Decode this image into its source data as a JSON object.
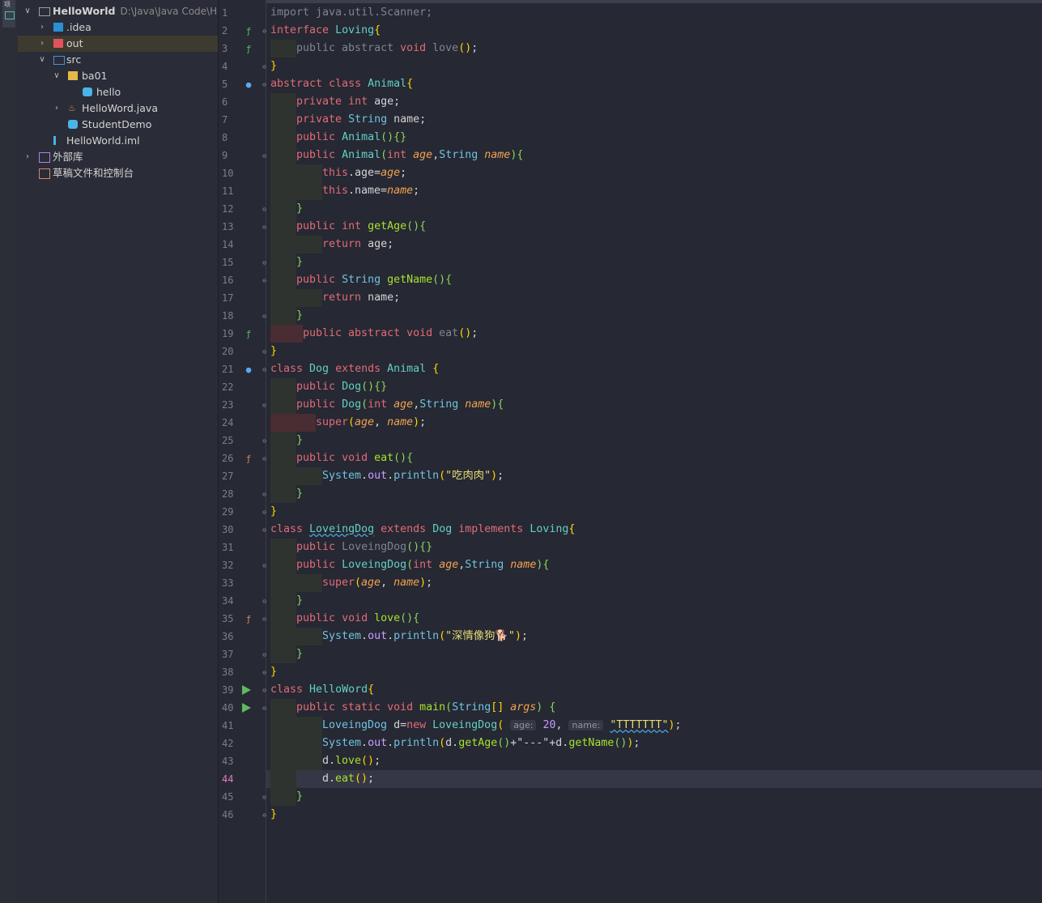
{
  "tool_strip": {
    "label": "项"
  },
  "project_tree": [
    {
      "label": "HelloWorld",
      "path": "D:\\Java\\Java Code\\He",
      "icon": "folder-icon",
      "arrow": "expanded"
    },
    {
      "label": ".idea",
      "icon": "idea-folder-icon",
      "arrow": "collapsed"
    },
    {
      "label": "out",
      "icon": "out-folder-icon",
      "arrow": "collapsed"
    },
    {
      "label": "src",
      "icon": "src-folder-icon",
      "arrow": "expanded"
    },
    {
      "label": "ba01",
      "icon": "package-icon",
      "arrow": "expanded"
    },
    {
      "label": "hello",
      "icon": "class-icon",
      "arrow": ""
    },
    {
      "label": "HelloWord.java",
      "icon": "java-file-icon",
      "arrow": "collapsed"
    },
    {
      "label": "StudentDemo",
      "icon": "class-icon",
      "arrow": ""
    },
    {
      "label": "HelloWorld.iml",
      "icon": "iml-file-icon",
      "arrow": ""
    },
    {
      "label": "外部库",
      "icon": "library-icon",
      "arrow": "collapsed"
    },
    {
      "label": "草稿文件和控制台",
      "icon": "scratch-icon",
      "arrow": ""
    }
  ],
  "editor": {
    "current_line": 44,
    "line_numbers": [
      "1",
      "2",
      "3",
      "4",
      "5",
      "6",
      "7",
      "8",
      "9",
      "10",
      "11",
      "12",
      "13",
      "14",
      "15",
      "16",
      "17",
      "18",
      "19",
      "20",
      "21",
      "22",
      "23",
      "24",
      "25",
      "26",
      "27",
      "28",
      "29",
      "30",
      "31",
      "32",
      "33",
      "34",
      "35",
      "36",
      "37",
      "38",
      "39",
      "40",
      "41",
      "42",
      "43",
      "44",
      "45",
      "46"
    ],
    "code": {
      "l1": "import java.util.Scanner;",
      "l2a": "interface",
      "l2b": "Loving",
      "l3a": "public abstract",
      "l3b": "void",
      "l3c": "love",
      "l5a": "abstract class",
      "l5b": "Animal",
      "l6a": "private",
      "l6b": "int",
      "l6c": "age;",
      "l7a": "private",
      "l7b": "String",
      "l7c": "name;",
      "l8a": "public",
      "l8b": "Animal",
      "l9a": "public",
      "l9b": "Animal",
      "l9c": "int",
      "l9d": "age",
      "l9e": "String",
      "l9f": "name",
      "l10a": "this",
      "l10b": ".age=",
      "l10c": "age",
      "l11a": "this",
      "l11b": ".name=",
      "l11c": "name",
      "l13a": "public",
      "l13b": "int",
      "l13c": "getAge",
      "l14a": "return",
      "l14b": "age;",
      "l16a": "public",
      "l16b": "String",
      "l16c": "getName",
      "l17a": "return",
      "l17b": "name;",
      "l19a": "public abstract",
      "l19b": "void",
      "l19c": "eat",
      "l21a": "class",
      "l21b": "Dog",
      "l21c": "extends",
      "l21d": "Animal",
      "l22a": "public",
      "l22b": "Dog",
      "l23a": "public",
      "l23b": "Dog",
      "l23c": "int",
      "l23d": "age",
      "l23e": "String",
      "l23f": "name",
      "l24a": "super",
      "l24b": "age",
      "l24c": "name",
      "l26a": "public",
      "l26b": "void",
      "l26c": "eat",
      "l27a": "System",
      "l27b": "out",
      "l27c": "println",
      "l27d": "\"吃肉肉\"",
      "l30a": "class",
      "l30b": "LoveingDog",
      "l30c": "extends",
      "l30d": "Dog",
      "l30e": "implements",
      "l30f": "Loving",
      "l31a": "public",
      "l31b": "LoveingDog",
      "l32a": "public",
      "l32b": "LoveingDog",
      "l32c": "int",
      "l32d": "age",
      "l32e": "String",
      "l32f": "name",
      "l33a": "super",
      "l33b": "age",
      "l33c": "name",
      "l35a": "public",
      "l35b": "void",
      "l35c": "love",
      "l36a": "System",
      "l36b": "out",
      "l36c": "println",
      "l36d": "\"深情像狗🐕\"",
      "l39a": "class",
      "l39b": "HelloWord",
      "l40a": "public static",
      "l40b": "void",
      "l40c": "main",
      "l40d": "String",
      "l40e": "[]",
      "l40f": "args",
      "l41a": "LoveingDog",
      "l41b": "d=",
      "l41c": "new",
      "l41d": "LoveingDog",
      "l41e": "age:",
      "l41f": "20",
      "l41g": "name:",
      "l41h": "\"TTTTTTT\"",
      "l42a": "System",
      "l42b": "out",
      "l42c": "println",
      "l42d": "d.",
      "l42e": "getAge",
      "l42f": "+\"---\"+d.",
      "l42g": "getName",
      "l43a": "d.",
      "l43b": "love",
      "l44a": "d.",
      "l44b": "eat"
    }
  }
}
